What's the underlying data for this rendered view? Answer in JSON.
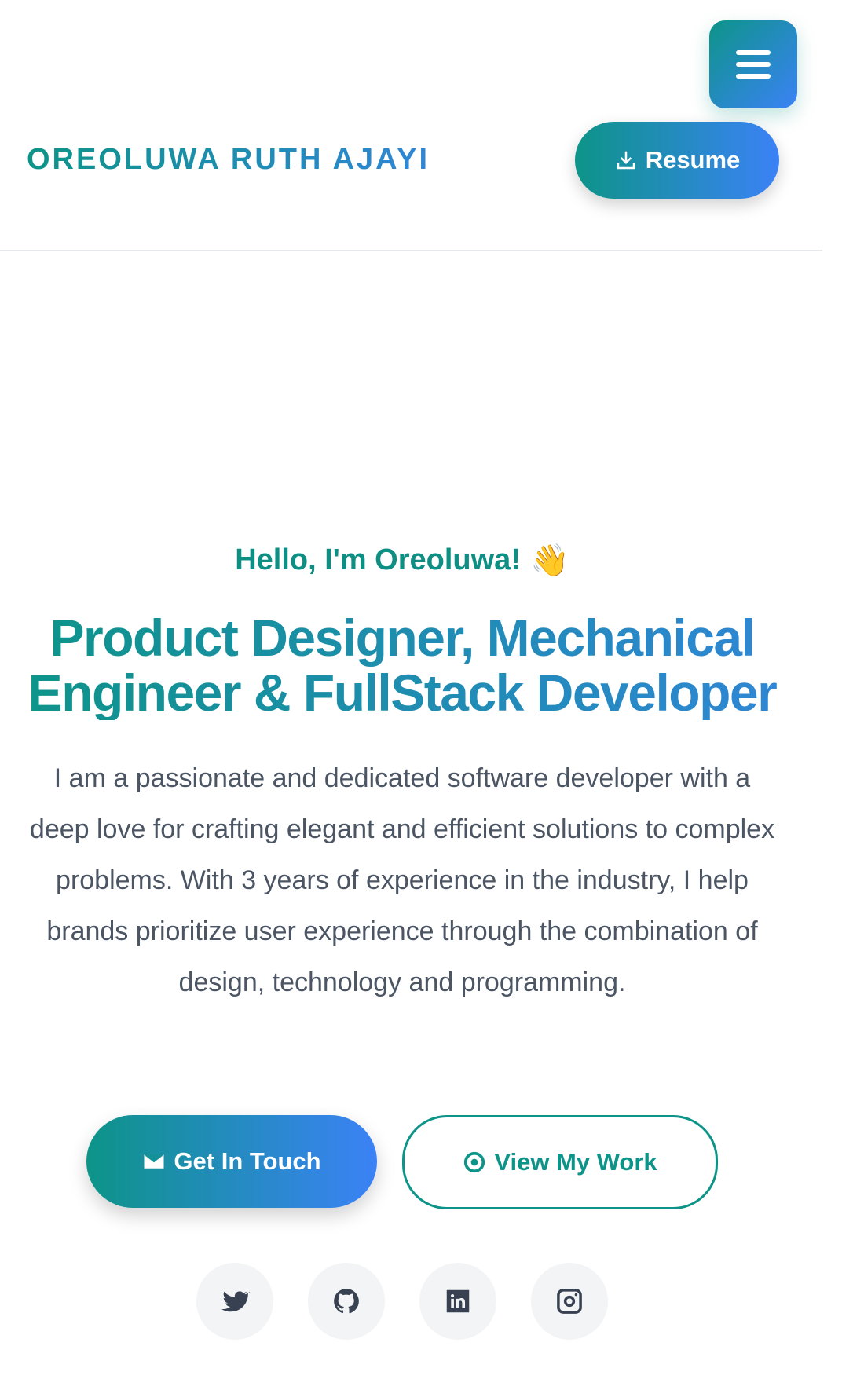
{
  "header": {
    "brand": "OREOLUWA RUTH AJAYI",
    "resume_label": "Resume",
    "menu_icon": "menu-icon"
  },
  "hero": {
    "greeting": "Hello, I'm Oreoluwa!",
    "greeting_emoji": "👋",
    "headline_line1": "Product Designer, Mechanical",
    "headline_line2": "Engineer & FullStack Developer",
    "bio": "I am a passionate and dedicated software developer with a deep love for crafting elegant and efficient solutions to complex problems. With 3 years of experience in the industry, I help brands prioritize user experience through the combination of design, technology and programming."
  },
  "cta": {
    "primary_label": "Get In Touch",
    "secondary_label": "View My Work"
  },
  "socials": [
    "twitter-icon",
    "github-icon",
    "linkedin-icon",
    "instagram-icon"
  ],
  "colors": {
    "teal": "#0d9488",
    "blue": "#3b82f6",
    "text": "#4b5563"
  }
}
